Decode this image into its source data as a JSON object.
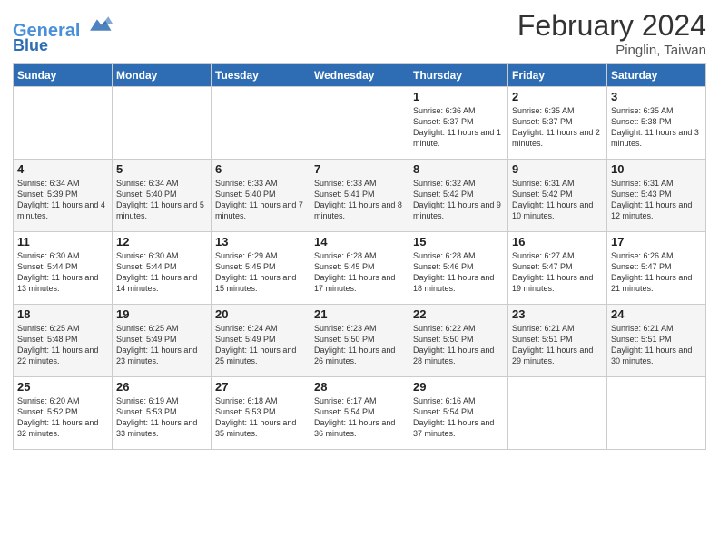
{
  "header": {
    "logo_line1": "General",
    "logo_line2": "Blue",
    "title": "February 2024",
    "location": "Pinglin, Taiwan"
  },
  "weekdays": [
    "Sunday",
    "Monday",
    "Tuesday",
    "Wednesday",
    "Thursday",
    "Friday",
    "Saturday"
  ],
  "weeks": [
    [
      {
        "day": "",
        "info": ""
      },
      {
        "day": "",
        "info": ""
      },
      {
        "day": "",
        "info": ""
      },
      {
        "day": "",
        "info": ""
      },
      {
        "day": "1",
        "info": "Sunrise: 6:36 AM\nSunset: 5:37 PM\nDaylight: 11 hours and 1 minute."
      },
      {
        "day": "2",
        "info": "Sunrise: 6:35 AM\nSunset: 5:37 PM\nDaylight: 11 hours and 2 minutes."
      },
      {
        "day": "3",
        "info": "Sunrise: 6:35 AM\nSunset: 5:38 PM\nDaylight: 11 hours and 3 minutes."
      }
    ],
    [
      {
        "day": "4",
        "info": "Sunrise: 6:34 AM\nSunset: 5:39 PM\nDaylight: 11 hours and 4 minutes."
      },
      {
        "day": "5",
        "info": "Sunrise: 6:34 AM\nSunset: 5:40 PM\nDaylight: 11 hours and 5 minutes."
      },
      {
        "day": "6",
        "info": "Sunrise: 6:33 AM\nSunset: 5:40 PM\nDaylight: 11 hours and 7 minutes."
      },
      {
        "day": "7",
        "info": "Sunrise: 6:33 AM\nSunset: 5:41 PM\nDaylight: 11 hours and 8 minutes."
      },
      {
        "day": "8",
        "info": "Sunrise: 6:32 AM\nSunset: 5:42 PM\nDaylight: 11 hours and 9 minutes."
      },
      {
        "day": "9",
        "info": "Sunrise: 6:31 AM\nSunset: 5:42 PM\nDaylight: 11 hours and 10 minutes."
      },
      {
        "day": "10",
        "info": "Sunrise: 6:31 AM\nSunset: 5:43 PM\nDaylight: 11 hours and 12 minutes."
      }
    ],
    [
      {
        "day": "11",
        "info": "Sunrise: 6:30 AM\nSunset: 5:44 PM\nDaylight: 11 hours and 13 minutes."
      },
      {
        "day": "12",
        "info": "Sunrise: 6:30 AM\nSunset: 5:44 PM\nDaylight: 11 hours and 14 minutes."
      },
      {
        "day": "13",
        "info": "Sunrise: 6:29 AM\nSunset: 5:45 PM\nDaylight: 11 hours and 15 minutes."
      },
      {
        "day": "14",
        "info": "Sunrise: 6:28 AM\nSunset: 5:45 PM\nDaylight: 11 hours and 17 minutes."
      },
      {
        "day": "15",
        "info": "Sunrise: 6:28 AM\nSunset: 5:46 PM\nDaylight: 11 hours and 18 minutes."
      },
      {
        "day": "16",
        "info": "Sunrise: 6:27 AM\nSunset: 5:47 PM\nDaylight: 11 hours and 19 minutes."
      },
      {
        "day": "17",
        "info": "Sunrise: 6:26 AM\nSunset: 5:47 PM\nDaylight: 11 hours and 21 minutes."
      }
    ],
    [
      {
        "day": "18",
        "info": "Sunrise: 6:25 AM\nSunset: 5:48 PM\nDaylight: 11 hours and 22 minutes."
      },
      {
        "day": "19",
        "info": "Sunrise: 6:25 AM\nSunset: 5:49 PM\nDaylight: 11 hours and 23 minutes."
      },
      {
        "day": "20",
        "info": "Sunrise: 6:24 AM\nSunset: 5:49 PM\nDaylight: 11 hours and 25 minutes."
      },
      {
        "day": "21",
        "info": "Sunrise: 6:23 AM\nSunset: 5:50 PM\nDaylight: 11 hours and 26 minutes."
      },
      {
        "day": "22",
        "info": "Sunrise: 6:22 AM\nSunset: 5:50 PM\nDaylight: 11 hours and 28 minutes."
      },
      {
        "day": "23",
        "info": "Sunrise: 6:21 AM\nSunset: 5:51 PM\nDaylight: 11 hours and 29 minutes."
      },
      {
        "day": "24",
        "info": "Sunrise: 6:21 AM\nSunset: 5:51 PM\nDaylight: 11 hours and 30 minutes."
      }
    ],
    [
      {
        "day": "25",
        "info": "Sunrise: 6:20 AM\nSunset: 5:52 PM\nDaylight: 11 hours and 32 minutes."
      },
      {
        "day": "26",
        "info": "Sunrise: 6:19 AM\nSunset: 5:53 PM\nDaylight: 11 hours and 33 minutes."
      },
      {
        "day": "27",
        "info": "Sunrise: 6:18 AM\nSunset: 5:53 PM\nDaylight: 11 hours and 35 minutes."
      },
      {
        "day": "28",
        "info": "Sunrise: 6:17 AM\nSunset: 5:54 PM\nDaylight: 11 hours and 36 minutes."
      },
      {
        "day": "29",
        "info": "Sunrise: 6:16 AM\nSunset: 5:54 PM\nDaylight: 11 hours and 37 minutes."
      },
      {
        "day": "",
        "info": ""
      },
      {
        "day": "",
        "info": ""
      }
    ]
  ]
}
